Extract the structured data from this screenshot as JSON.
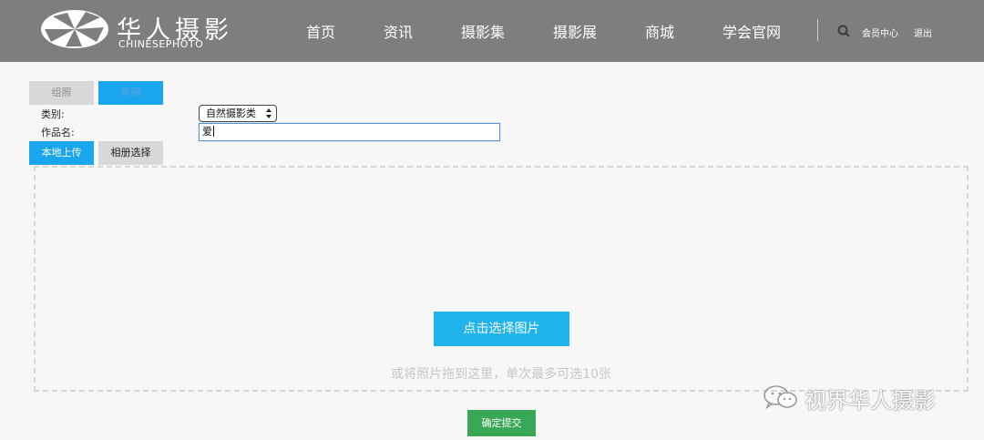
{
  "header": {
    "logo_cn": "华人摄影",
    "logo_en": "CHINESEPHOTO",
    "nav": [
      "首页",
      "资讯",
      "摄影集",
      "摄影展",
      "商城",
      "学会官网"
    ],
    "member_center": "会员中心",
    "logout": "退出"
  },
  "form": {
    "tabs": {
      "group": "组照",
      "single": "单照"
    },
    "category_label": "类别:",
    "category_value": "自然摄影类",
    "title_label": "作品名:",
    "title_value": "爱",
    "upload_local": "本地上传",
    "upload_album": "相册选择"
  },
  "upload": {
    "pick_button": "点击选择图片",
    "hint": "或将照片拖到这里，单次最多可选10张"
  },
  "submit": "确定提交",
  "watermark": "视界华人摄影",
  "colors": {
    "header_bg": "#7c7e80",
    "accent_blue": "#1aa6ee",
    "submit_green": "#39a855"
  }
}
